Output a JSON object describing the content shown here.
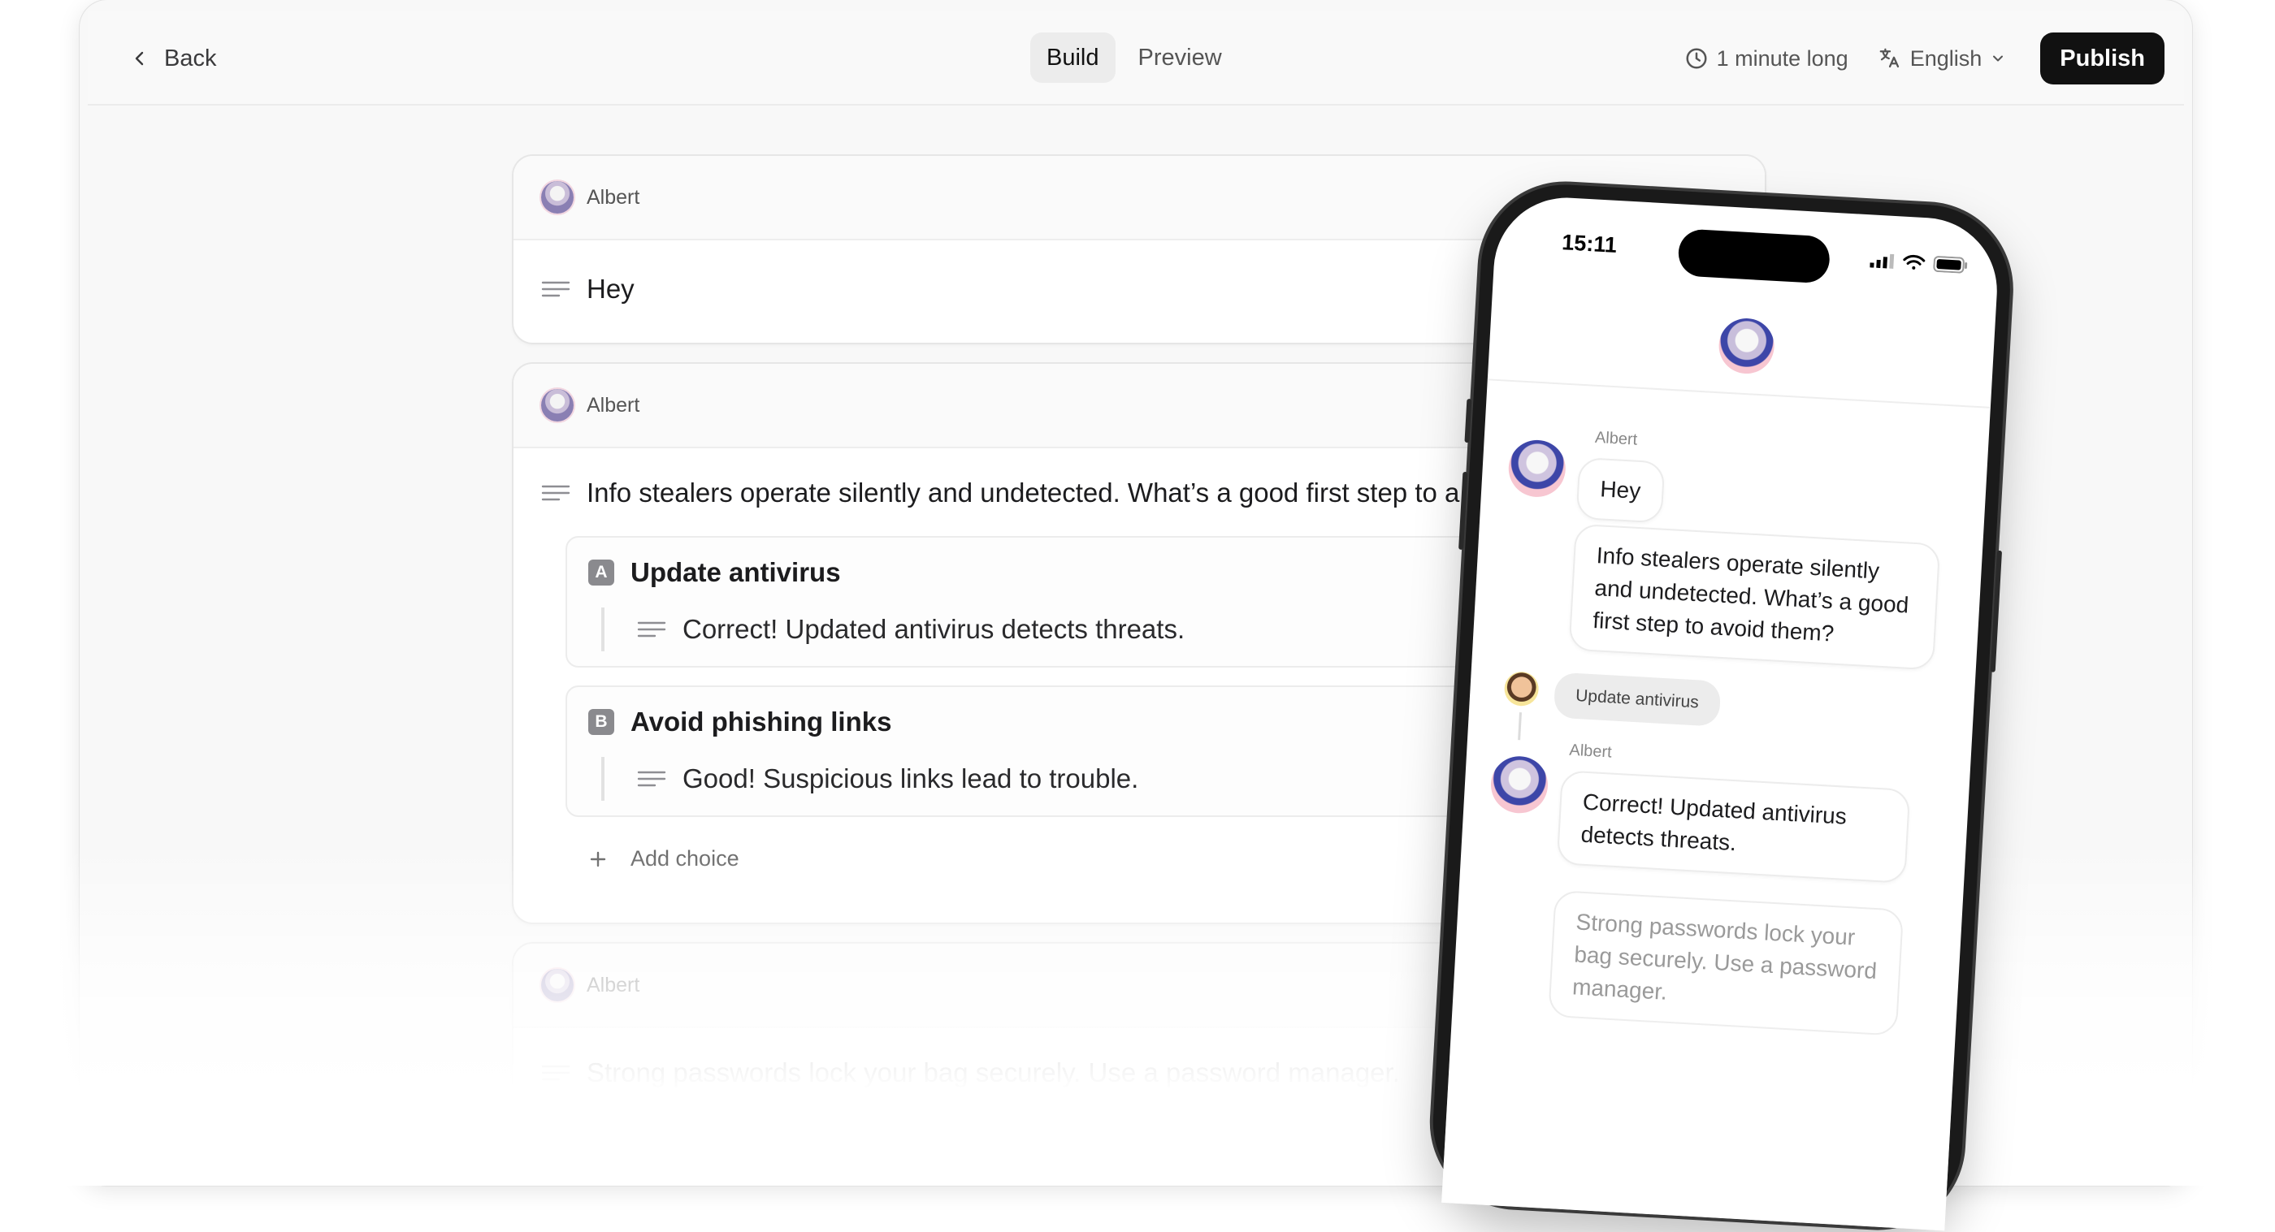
{
  "toolbar": {
    "back_label": "Back",
    "tabs": [
      {
        "label": "Build",
        "active": true
      },
      {
        "label": "Preview",
        "active": false
      }
    ],
    "duration": "1 minute long",
    "language": "English",
    "publish_label": "Publish"
  },
  "editor": {
    "cards": [
      {
        "speaker": "Albert",
        "message": "Hey"
      },
      {
        "speaker": "Albert",
        "message": "Info stealers operate silently and undetected. What’s a good first step to a",
        "choices": [
          {
            "letter": "A",
            "title": "Update antivirus",
            "response": "Correct! Updated antivirus detects threats."
          },
          {
            "letter": "B",
            "title": "Avoid phishing links",
            "response": "Good! Suspicious links lead to trouble."
          }
        ],
        "add_choice_label": "Add choice"
      },
      {
        "speaker": "Albert",
        "message": "Strong passwords lock your bag securely. Use a password manager."
      }
    ]
  },
  "phone": {
    "time": "15:11",
    "messages": {
      "speaker_1": "Albert",
      "greeting": "Hey",
      "question": "Info stealers operate silently and undetected. What’s a good first step to avoid them?",
      "user_choice": "Update antivirus",
      "speaker_2": "Albert",
      "feedback": "Correct! Updated antivirus detects threats.",
      "next": "Strong passwords lock your bag securely. Use a password manager."
    }
  },
  "colors": {
    "accent": "#111111",
    "background": "#f8f8f8",
    "card": "#ffffff"
  }
}
